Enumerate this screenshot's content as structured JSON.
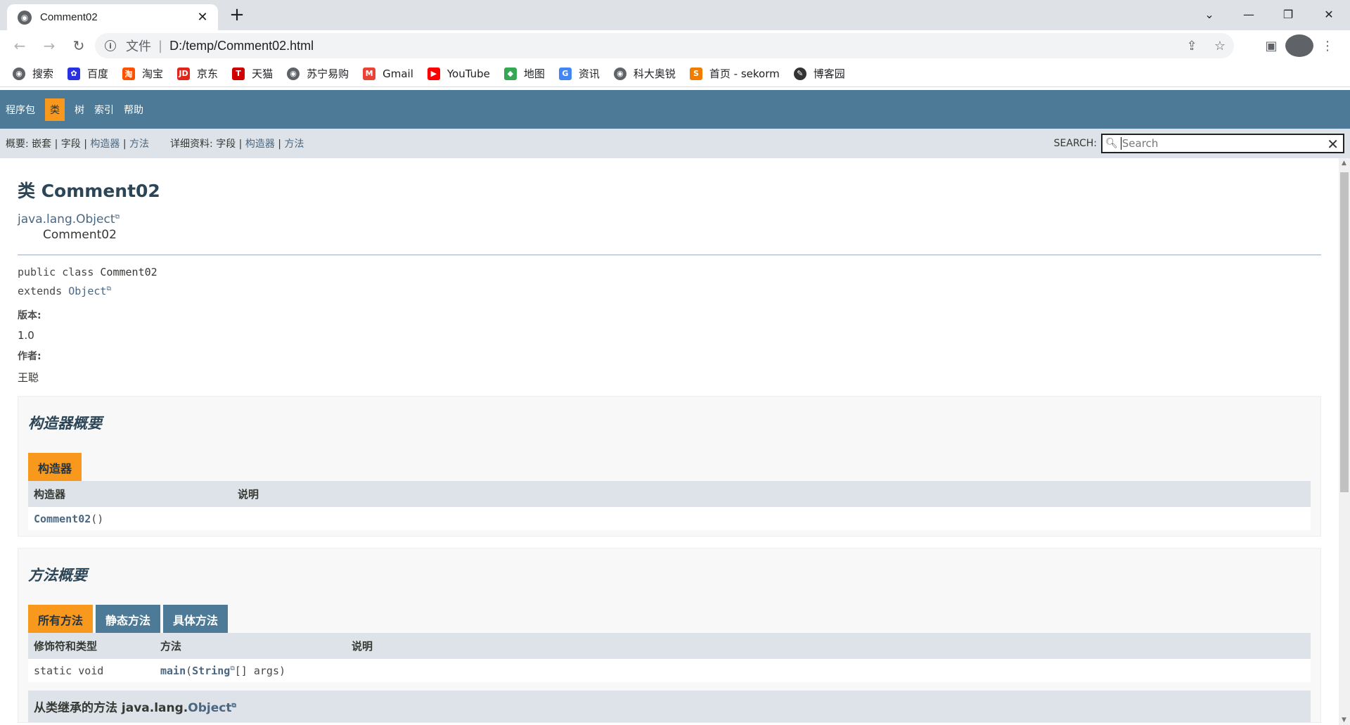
{
  "browser": {
    "tab_title": "Comment02",
    "url_scheme": "文件",
    "url": "D:/temp/Comment02.html",
    "bookmarks": [
      {
        "label": "搜索",
        "icon": "globe-icon",
        "color": "#5f6368"
      },
      {
        "label": "百度",
        "icon": "baidu-icon",
        "color": "#2932e1"
      },
      {
        "label": "淘宝",
        "icon": "taobao-icon",
        "color": "#ff5000"
      },
      {
        "label": "京东",
        "icon": "jd-icon",
        "color": "#e1251b"
      },
      {
        "label": "天猫",
        "icon": "tmall-icon",
        "color": "#d10000"
      },
      {
        "label": "苏宁易购",
        "icon": "globe-icon",
        "color": "#5f6368"
      },
      {
        "label": "Gmail",
        "icon": "gmail-icon",
        "color": "#ea4335"
      },
      {
        "label": "YouTube",
        "icon": "youtube-icon",
        "color": "#ff0000"
      },
      {
        "label": "地图",
        "icon": "maps-icon",
        "color": "#34a853"
      },
      {
        "label": "资讯",
        "icon": "news-icon",
        "color": "#4285f4"
      },
      {
        "label": "科大奥锐",
        "icon": "globe-icon",
        "color": "#5f6368"
      },
      {
        "label": "首页 - sekorm",
        "icon": "sekorm-icon",
        "color": "#f07c00"
      },
      {
        "label": "博客园",
        "icon": "cnblogs-icon",
        "color": "#333333"
      }
    ]
  },
  "javadoc": {
    "topnav": [
      "程序包",
      "类",
      "树",
      "索引",
      "帮助"
    ],
    "subnav": {
      "summary_label": "概要:",
      "summary_items": [
        "嵌套",
        "字段",
        "构造器",
        "方法"
      ],
      "detail_label": "详细资料:",
      "detail_items": [
        "字段",
        "构造器",
        "方法"
      ],
      "search_label": "SEARCH:",
      "search_placeholder": "Search"
    },
    "class_title": "类 Comment02",
    "inheritance": [
      "java.lang.Object",
      "Comment02"
    ],
    "signature": {
      "modifiers": "public class",
      "name": "Comment02",
      "extends_kw": "extends",
      "extends": "Object"
    },
    "notes": [
      {
        "label": "版本:",
        "value": "1.0"
      },
      {
        "label": "作者:",
        "value": "王聪"
      }
    ],
    "constructor_summary": {
      "heading": "构造器概要",
      "tab": "构造器",
      "headers": [
        "构造器",
        "说明"
      ],
      "rows": [
        {
          "name": "Comment02",
          "params": "()",
          "desc": ""
        }
      ]
    },
    "method_summary": {
      "heading": "方法概要",
      "tabs": [
        "所有方法",
        "静态方法",
        "具体方法"
      ],
      "headers": [
        "修饰符和类型",
        "方法",
        "说明"
      ],
      "rows": [
        {
          "modifier": "static void",
          "name": "main",
          "paren_open": "(",
          "param_type": "String",
          "param_rest": "[]  args)",
          "desc": ""
        }
      ]
    },
    "inherited": {
      "prefix": "从类继承的方法 java.lang.",
      "link": "Object"
    }
  }
}
